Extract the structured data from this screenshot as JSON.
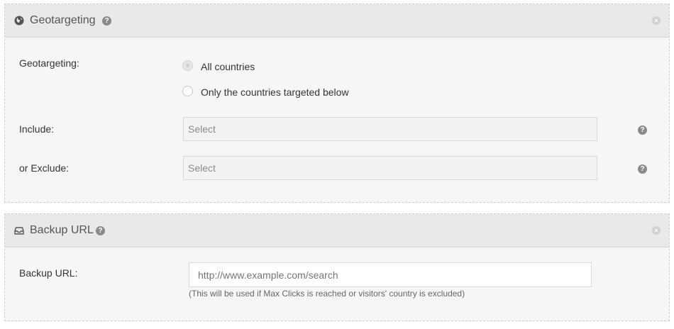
{
  "geotargeting": {
    "title": "Geotargeting",
    "header_icon": "globe-icon",
    "field_label": "Geotargeting:",
    "options": [
      {
        "label": "All countries",
        "selected": true
      },
      {
        "label": "Only the countries targeted below",
        "selected": false
      }
    ],
    "include_label": "Include:",
    "include_placeholder": "Select",
    "exclude_label": "or Exclude:",
    "exclude_placeholder": "Select"
  },
  "backup_url": {
    "title": "Backup URL",
    "header_icon": "inbox-icon",
    "field_label": "Backup URL:",
    "placeholder": "http://www.example.com/search",
    "value": "",
    "hint": "(This will be used if Max Clicks is reached or visitors' country is excluded)"
  },
  "icons": {
    "help_glyph": "?",
    "close_glyph": "×"
  }
}
